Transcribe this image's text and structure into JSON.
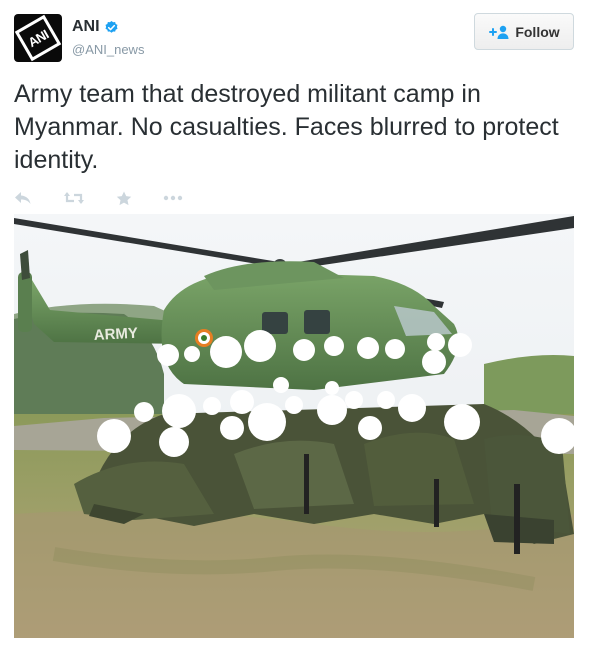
{
  "account": {
    "display_name": "ANI",
    "handle": "@ANI_news",
    "avatar_text": "ANI",
    "verified": true
  },
  "follow_button": {
    "label": "Follow"
  },
  "tweet": {
    "text": "Army team that destroyed militant camp in Myanmar. No casualties. Faces blurred to protect identity."
  },
  "actions": [
    "reply-icon",
    "retweet-icon",
    "favorite-icon",
    "more-icon"
  ],
  "media": {
    "helicopter_marking": "ARMY"
  },
  "colors": {
    "text": "#292f33",
    "handle": "#8899a6",
    "verified": "#1da1f2",
    "action_icons": "#ccd6dd",
    "button_border": "#cfd9de"
  }
}
